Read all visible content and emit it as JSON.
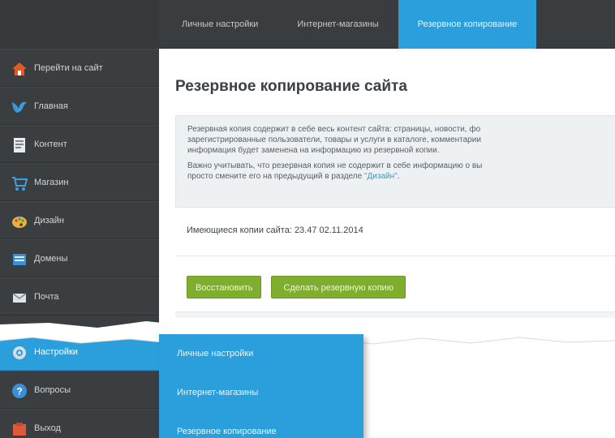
{
  "topnav": {
    "tabs": [
      {
        "label": "Личные настройки",
        "active": false
      },
      {
        "label": "Интернет-магазины",
        "active": false
      },
      {
        "label": "Резервное копирование",
        "active": true
      }
    ]
  },
  "sidebar": {
    "items": [
      {
        "label": "Перейти на сайт",
        "icon": "home-icon"
      },
      {
        "label": "Главная",
        "icon": "bird-icon"
      },
      {
        "label": "Контент",
        "icon": "document-icon"
      },
      {
        "label": "Магазин",
        "icon": "cart-icon"
      },
      {
        "label": "Дизайн",
        "icon": "palette-icon"
      },
      {
        "label": "Домены",
        "icon": "domains-icon"
      },
      {
        "label": "Почта",
        "icon": "mail-icon"
      }
    ],
    "lower_items": [
      {
        "label": "Настройки",
        "icon": "gear-icon",
        "active": true
      },
      {
        "label": "Вопросы",
        "icon": "question-icon"
      },
      {
        "label": "Выход",
        "icon": "exit-icon"
      }
    ]
  },
  "main": {
    "title": "Резервное копирование сайта",
    "info_line1": "Резервная копия содержит в себе весь контент сайта: страницы, новости, фо",
    "info_line2": "зарегистрированные пользователи, товары и услуги в каталоге, комментарии",
    "info_line3": "информация будет заменена на информацию из резервной копии.",
    "info_line4": "Важно учитывать, что резервная копия не содержит в себе информацию о вы",
    "info_line5_prefix": "просто смените его на предыдущий в разделе ",
    "info_link": "\"Дизайн\"",
    "info_line5_suffix": ".",
    "copies_label": "Имеющиеся копии сайта:",
    "copies_value": "23.47 02.11.2014",
    "restore_button": "Восстановить",
    "backup_button": "Сделать резервную копию"
  },
  "submenu": {
    "items": [
      {
        "label": "Личные настройки"
      },
      {
        "label": "Интернет-магазины"
      },
      {
        "label": "Резервное копирование"
      }
    ]
  },
  "colors": {
    "accent": "#2a9fdc",
    "sidebar_bg": "#3b3e41",
    "button_green": "#7fae2e"
  }
}
